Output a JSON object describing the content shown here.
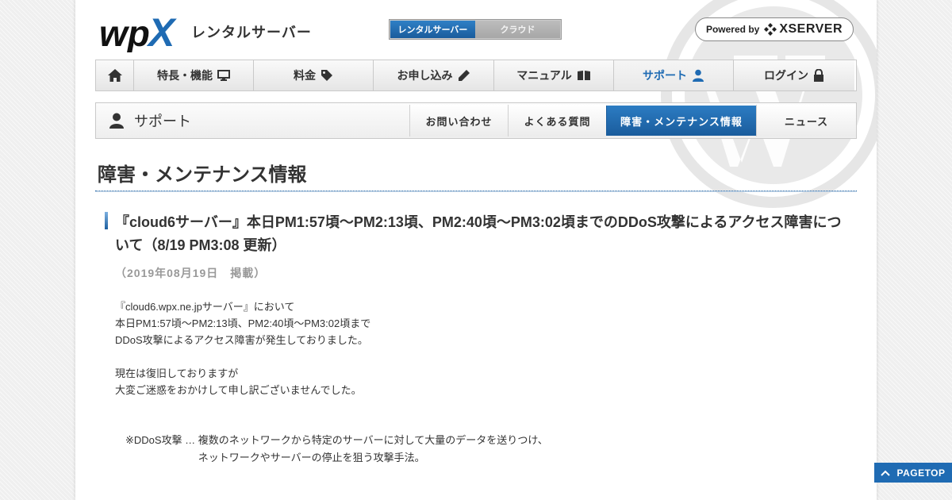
{
  "header": {
    "logo_text": "wpX",
    "logo_subtitle": "レンタルサーバー",
    "switch_tabs": [
      {
        "label": "レンタルサーバー",
        "active": true
      },
      {
        "label": "クラウド",
        "active": false
      }
    ],
    "xserver": {
      "powered": "Powered by",
      "name": "XSERVER"
    }
  },
  "global_nav": {
    "items": [
      {
        "label": "",
        "icon": "home-icon"
      },
      {
        "label": "特長・機能",
        "icon": "monitor-icon"
      },
      {
        "label": "料金",
        "icon": "tag-icon"
      },
      {
        "label": "お申し込み",
        "icon": "pencil-icon"
      },
      {
        "label": "マニュアル",
        "icon": "book-icon"
      },
      {
        "label": "サポート",
        "icon": "user-icon",
        "active": true
      },
      {
        "label": "ログイン",
        "icon": "lock-icon"
      }
    ]
  },
  "sub_nav": {
    "title": "サポート",
    "items": [
      {
        "label": "お問い合わせ"
      },
      {
        "label": "よくある質問"
      },
      {
        "label": "障害・メンテナンス情報",
        "active": true
      },
      {
        "label": "ニュース"
      }
    ]
  },
  "main": {
    "page_title": "障害・メンテナンス情報",
    "post": {
      "title": "『cloud6サーバー』本日PM1:57頃～PM2:13頃、PM2:40頃～PM3:02頃までのDDoS攻撃によるアクセス障害について（8/19 PM3:08 更新）",
      "date": "（2019年08月19日　掲載）",
      "paragraph1": [
        "『cloud6.wpx.ne.jpサーバー』において",
        "本日PM1:57頃～PM2:13頃、PM2:40頃～PM3:02頃まで",
        "DDoS攻撃によるアクセス障害が発生しておりました。"
      ],
      "paragraph2": [
        "現在は復旧しておりますが",
        "大変ご迷惑をおかけして申し訳ございませんでした。"
      ],
      "note_term": "※DDoS攻撃 … ",
      "note_desc": [
        "複数のネットワークから特定のサーバーに対して大量のデータを送りつけ、",
        "ネットワークやサーバーの停止を狙う攻撃手法。"
      ]
    }
  },
  "pagetop": {
    "label": "PAGETOP"
  },
  "colors": {
    "accent": "#1f6bb3",
    "text": "#333333",
    "date": "#999999"
  }
}
